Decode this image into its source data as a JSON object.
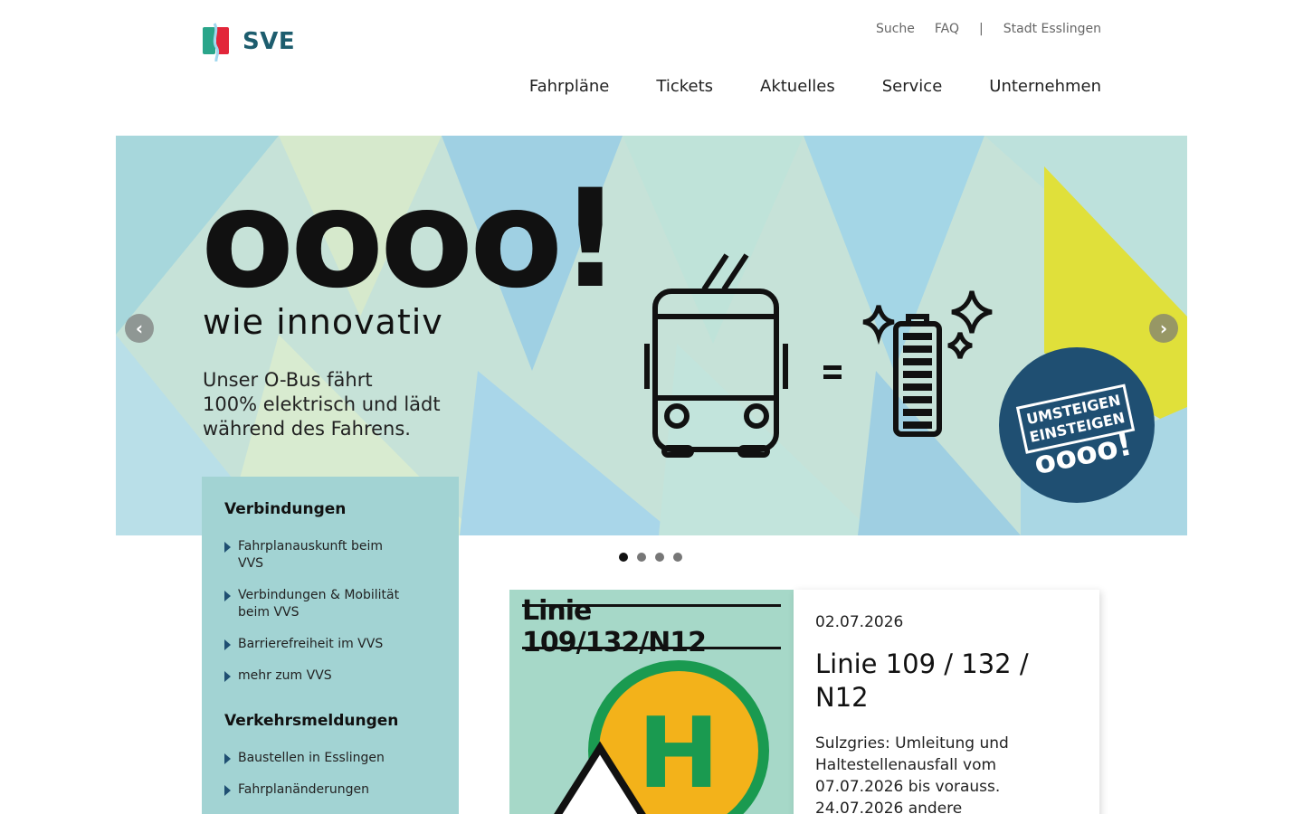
{
  "header": {
    "logo_text": "SVE",
    "topnav": [
      "Suche",
      "FAQ",
      "|",
      "Stadt Esslingen"
    ],
    "mainnav": [
      "Fahrpläne",
      "Tickets",
      "Aktuelles",
      "Service",
      "Unternehmen"
    ]
  },
  "slider": {
    "headline": "oooo!",
    "subheadline": "wie innovativ",
    "text_lines": [
      "Unser O-Bus fährt",
      "100% elektrisch und lädt",
      "während des Fahrens."
    ],
    "badge_lines": [
      "UMSTEIGEN",
      "EINSTEIGEN",
      "oooo!"
    ],
    "prev_label": "‹",
    "next_label": "›",
    "dots": 4,
    "active_dot": 0
  },
  "sidebar": {
    "sections": [
      {
        "title": "Verbindungen",
        "items": [
          "Fahrplanauskunft beim VVS",
          "Verbindungen & Mobilität beim VVS",
          "Barrierefreiheit im VVS",
          "mehr zum VVS"
        ]
      },
      {
        "title": "Verkehrsmeldungen",
        "items": [
          "Baustellen in Esslingen",
          "Fahrplanänderungen"
        ]
      }
    ]
  },
  "news": {
    "image_label": "Linie 109/132/N12",
    "date": "02.07.2026",
    "title": "Linie 109 / 132 / N12",
    "text": "Sulzgries: Umleitung und Haltestellenausfall vom 07.07.2026 bis vorauss. 24.07.2026 andere"
  },
  "colors": {
    "brand": "#1d5d6e",
    "sidebar_bg": "#a2d3d3",
    "badge_bg": "#1f4f72",
    "accent_yellow": "#e0e03a"
  }
}
